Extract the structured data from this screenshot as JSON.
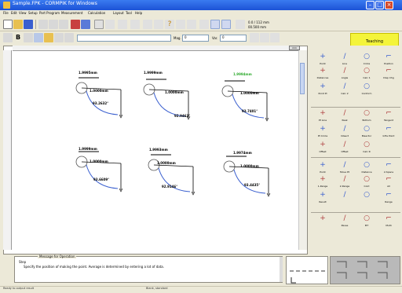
{
  "window": {
    "title": "Sample.FPK - CORMPIK for Windows",
    "title_icon": "app-icon",
    "controls": [
      "minimize-icon",
      "maximize-icon",
      "close-icon"
    ]
  },
  "menu": [
    "File",
    "Edit",
    "View",
    "Setup",
    "Part Program",
    "Measurement",
    "Calculation",
    "Layout",
    "Tool",
    "Help"
  ],
  "toolbar": {
    "readout_top": "0.0 / 112 mm",
    "readout_bottom": "00.500 mm",
    "mag_label": "Mag.",
    "mag_value": "0",
    "var_label": "Var.",
    "var_value": "0",
    "teaching_label": "Teaching"
  },
  "canvas": {
    "tab_label": "mm",
    "measurements": [
      {
        "dia": "1.9995mm",
        "radius": "1.0000mm",
        "angle": "93.2632°",
        "highlight": false
      },
      {
        "dia": "1.9999mm",
        "radius": "1.0000mm",
        "angle": "92.9463°",
        "highlight": false
      },
      {
        "dia": "1.9994mm",
        "radius": "1.0000mm",
        "angle": "93.7401°",
        "highlight": true
      },
      {
        "dia": "1.9999mm",
        "radius": "1.0000mm",
        "angle": "93.6609°",
        "highlight": false
      },
      {
        "dia": "1.9993mm",
        "radius": "1.0000mm",
        "angle": "92.9146°",
        "highlight": false
      },
      {
        "dia": "1.9974mm",
        "radius": "1.0000mm",
        "angle": "93.4435°",
        "highlight": false
      }
    ]
  },
  "tools": {
    "row1": [
      {
        "label": "Point",
        "icon": "point-icon"
      },
      {
        "label": "Line",
        "icon": "line-icon"
      },
      {
        "label": "Circle",
        "icon": "circle-icon"
      },
      {
        "label": "Position",
        "icon": "position-icon"
      }
    ],
    "row2": [
      {
        "label": "Distances",
        "icon": "distance-icon"
      },
      {
        "label": "Angle",
        "icon": "angle-icon"
      },
      {
        "label": "Calc 1",
        "icon": "calc1-icon"
      },
      {
        "label": "Disp Chg",
        "icon": "disp-chg-icon"
      }
    ],
    "row3": [
      {
        "label": "Point Pl",
        "icon": "point-pl-icon"
      },
      {
        "label": "Calc 2",
        "icon": "calc2-icon"
      },
      {
        "label": "Conform",
        "icon": "conform-icon"
      }
    ],
    "row4": [
      {
        "label": "Pt Line",
        "icon": "pt-line-icon"
      },
      {
        "label": "Peak",
        "icon": "peak-icon"
      },
      {
        "label": "Bottom",
        "icon": "bottom-icon"
      },
      {
        "label": "Tangent",
        "icon": "tangent-icon"
      }
    ],
    "row5": [
      {
        "label": "Pt Circle",
        "icon": "pt-circle-icon"
      },
      {
        "label": "Intsect",
        "icon": "intersect-icon"
      },
      {
        "label": "Bisector",
        "icon": "bisector-icon"
      },
      {
        "label": "Infle Point",
        "icon": "inflection-icon"
      }
    ],
    "row6": [
      {
        "label": "Offset",
        "icon": "offset-icon"
      },
      {
        "label": "Offset",
        "icon": "offset2-icon"
      },
      {
        "label": "Calc R",
        "icon": "calc-r-icon"
      }
    ],
    "row7": [
      {
        "label": "Point",
        "icon": "point2-icon"
      },
      {
        "label": "Move Pt",
        "icon": "move-pt-icon"
      },
      {
        "label": "Distance",
        "icon": "distance2-icon"
      },
      {
        "label": "2-Space",
        "icon": "2-space-icon"
      }
    ],
    "row8": [
      {
        "label": "1-Range",
        "icon": "1-range-icon"
      },
      {
        "label": "2-Range",
        "icon": "2-range-icon"
      },
      {
        "label": "Cont",
        "icon": "cont-icon"
      },
      {
        "label": "All",
        "icon": "all-icon"
      }
    ],
    "row9": [
      {
        "label": "Result",
        "icon": "result-icon"
      },
      {
        "label": "",
        "icon": "blank-icon"
      },
      {
        "label": "",
        "icon": "blank2-icon"
      },
      {
        "label": "Range",
        "icon": "range-icon"
      }
    ],
    "row10": [
      {
        "label": "",
        "icon": "run-icon"
      },
      {
        "label": "Pause",
        "icon": "pause-icon"
      },
      {
        "label": "MT",
        "icon": "mt-icon"
      },
      {
        "label": "Multi",
        "icon": "multi-icon"
      }
    ]
  },
  "message": {
    "title": "Message for Operation",
    "line1": "Step",
    "line2": "Specify the position of making the point. Average is determined by entering a lot of data."
  },
  "status": {
    "left": "Ready to output result",
    "mid": "Blank, standard"
  },
  "colors": {
    "title_bar": "#1c52d6",
    "teaching": "#f4f43a",
    "arc_blue": "#3a5fcf",
    "highlight_green": "#2eaa2e"
  }
}
